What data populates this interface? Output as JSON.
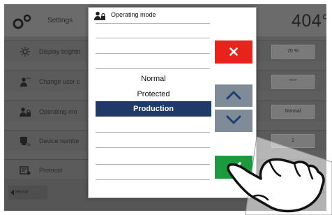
{
  "screen": {
    "title": "Settings",
    "temperature": "404°C",
    "rows": [
      {
        "icon": "sun-icon",
        "label": "Display brightn",
        "value": "70 %"
      },
      {
        "icon": "user-stars-icon",
        "label": "Change user c",
        "value": "****"
      },
      {
        "icon": "user-lock-icon",
        "label": "Operating mo",
        "value": "Normal"
      },
      {
        "icon": "device-number-icon",
        "label": "Device numbe",
        "value": "1"
      },
      {
        "icon": "protocol-icon",
        "label": "Protocol",
        "value": ""
      }
    ],
    "footer": {
      "home_label": "Home",
      "clock": "01"
    }
  },
  "dialog": {
    "title": "Operating mode",
    "icon": "user-lock-icon",
    "options": [
      {
        "label": "Normal",
        "selected": false
      },
      {
        "label": "Protected",
        "selected": false
      },
      {
        "label": "Production",
        "selected": true
      }
    ],
    "buttons": {
      "close": "close-icon",
      "up": "chevron-up-icon",
      "down": "chevron-down-icon",
      "ok": "check-icon"
    }
  },
  "colors": {
    "close": "#e8231c",
    "arrows": "#7f8b96",
    "ok": "#1e9a3e",
    "selection": "#1f3a68"
  }
}
